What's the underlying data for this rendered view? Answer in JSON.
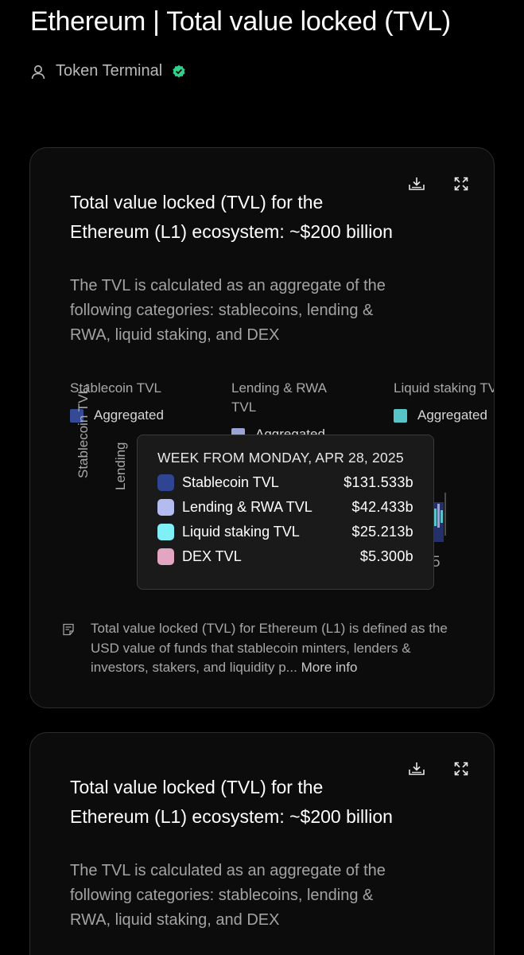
{
  "page": {
    "title": "Ethereum | Total value locked (TVL)",
    "author": "Token Terminal"
  },
  "card": {
    "title": "Total value locked (TVL) for the Ethereum (L1) ecosystem: ~$200 billion",
    "subtitle": "The TVL is calculated as an aggregate of the following categories: stablecoins, lending & RWA, liquid staking, and DEX",
    "legend": [
      {
        "title": "Stablecoin TVL",
        "item": "Aggregated",
        "color": "#354a97"
      },
      {
        "title": "Lending & RWA TVL",
        "item": "Aggregated",
        "color": "#9aa4d6"
      },
      {
        "title": "Liquid staking TVL",
        "item": "Aggregated",
        "color": "#57c4c8"
      }
    ],
    "y_axis_label": "Stablecoin TVL,",
    "y_axis_label_2": "Lending",
    "x_tick_partial": "5",
    "tooltip": {
      "header": "WEEK FROM MONDAY, APR 28, 2025",
      "rows": [
        {
          "label": "Stablecoin TVL",
          "value": "$131.533b",
          "color": "#2f4493"
        },
        {
          "label": "Lending & RWA TVL",
          "value": "$42.433b",
          "color": "#b4bbef"
        },
        {
          "label": "Liquid staking TVL",
          "value": "$25.213b",
          "color": "#7ff0f6"
        },
        {
          "label": "DEX TVL",
          "value": "$5.300b",
          "color": "#e3a6c2"
        }
      ]
    },
    "definition": "Total value locked (TVL) for Ethereum (L1) is defined as the USD value of funds that stablecoin minters, lenders & investors, stakers, and liquidity p...",
    "more_info": "More info"
  },
  "card2": {
    "title": "Total value locked (TVL) for the Ethereum (L1) ecosystem: ~$200 billion",
    "subtitle": "The TVL is calculated as an aggregate of the following categories: stablecoins, lending & RWA, liquid staking, and DEX"
  },
  "colors": {
    "background": "#000000",
    "card_background": "#0c0c0c",
    "verified": "#2fd18b"
  },
  "icons": [
    "user-icon",
    "verified-icon",
    "download-icon",
    "expand-icon",
    "document-icon"
  ]
}
